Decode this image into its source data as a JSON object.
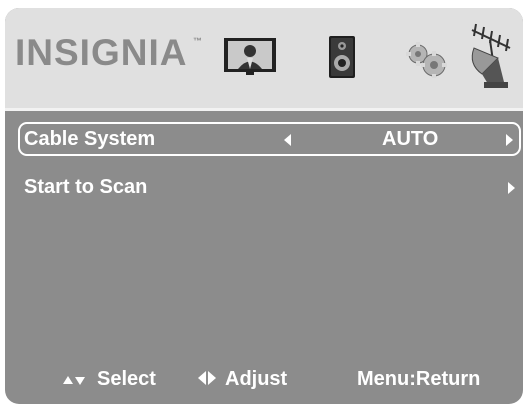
{
  "header": {
    "brand": "INSIGNIA",
    "trademark": "™",
    "icons": [
      "picture-icon",
      "audio-icon",
      "settings-icon",
      "channel-icon"
    ]
  },
  "menu": {
    "items": [
      {
        "label": "Cable System",
        "value": "AUTO"
      },
      {
        "label": "Start to Scan"
      }
    ]
  },
  "footer": {
    "select_label": "Select",
    "adjust_label": "Adjust",
    "return_label": "Menu:Return"
  },
  "colors": {
    "background": "#8c8c8c",
    "header": "#e0e0e0",
    "text": "#ffffff"
  }
}
